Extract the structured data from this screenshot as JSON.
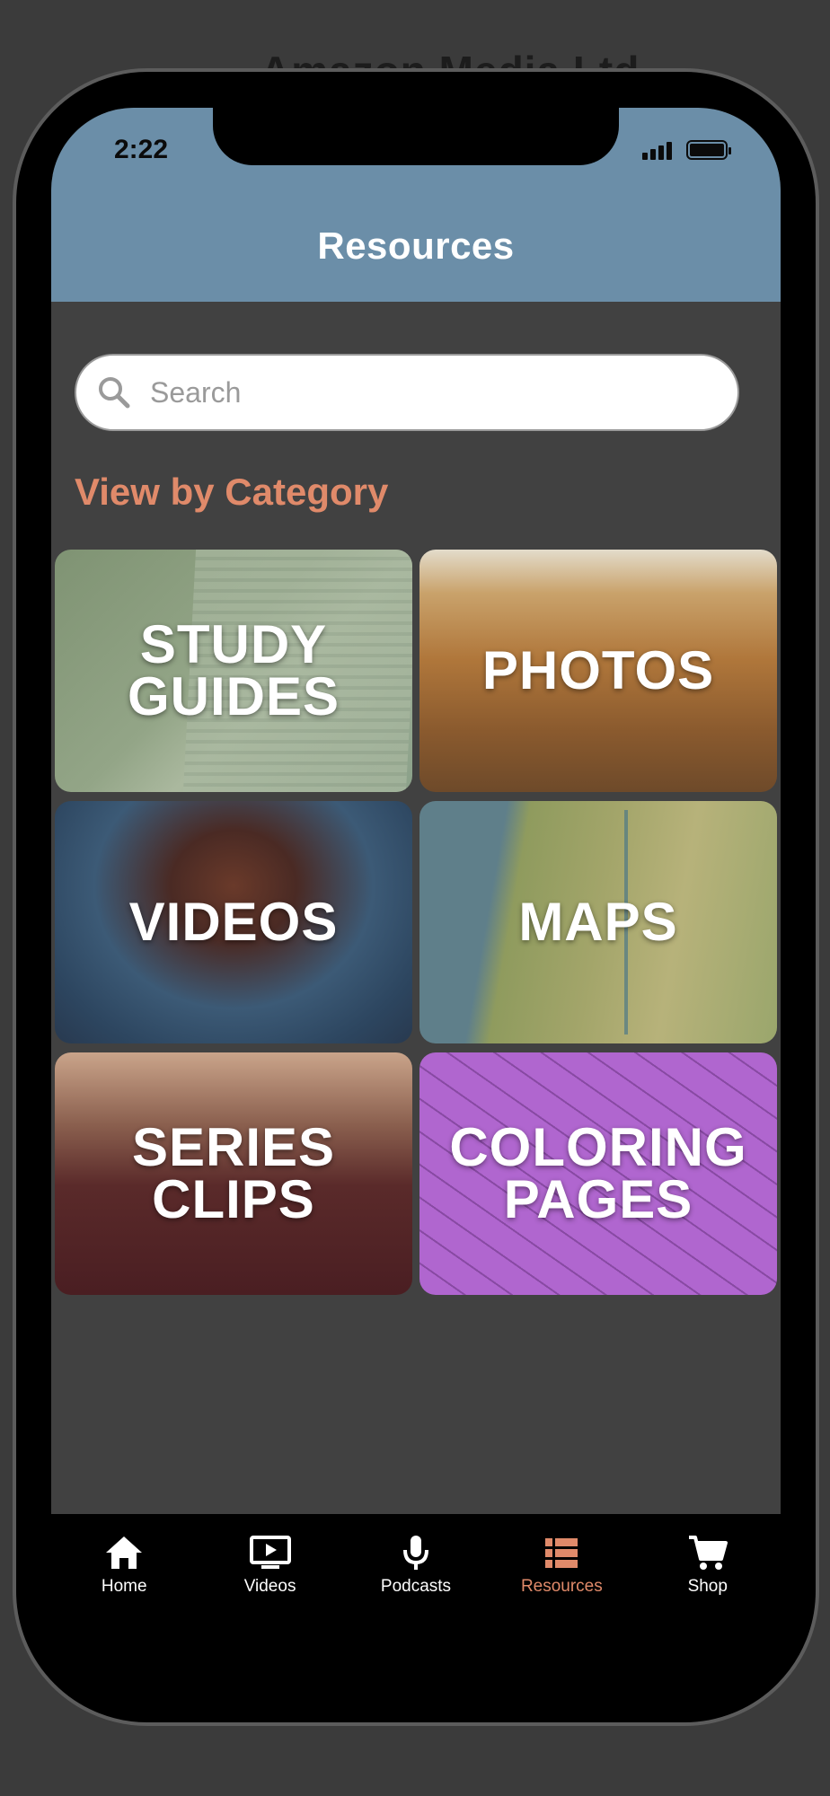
{
  "backdrop": {
    "title": "Amazon Media Ltd"
  },
  "status_bar": {
    "time": "2:22",
    "icons": [
      "cellular-signal-icon",
      "battery-icon"
    ]
  },
  "header": {
    "title": "Resources",
    "color": "#6b8ea8"
  },
  "search": {
    "placeholder": "Search",
    "value": "",
    "icon": "search-icon"
  },
  "section": {
    "heading": "View by Category",
    "heading_color": "#e08a6a"
  },
  "categories": [
    {
      "label_lines": [
        "STUDY",
        "GUIDES"
      ]
    },
    {
      "label_lines": [
        "PHOTOS"
      ]
    },
    {
      "label_lines": [
        "VIDEOS"
      ]
    },
    {
      "label_lines": [
        "MAPS"
      ]
    },
    {
      "label_lines": [
        "SERIES",
        "CLIPS"
      ]
    },
    {
      "label_lines": [
        "COLORING",
        "PAGES"
      ]
    }
  ],
  "tabbar": {
    "active_color": "#e08a6a",
    "items": [
      {
        "label": "Home",
        "icon": "home-icon"
      },
      {
        "label": "Videos",
        "icon": "video-play-icon"
      },
      {
        "label": "Podcasts",
        "icon": "microphone-icon"
      },
      {
        "label": "Resources",
        "icon": "list-icon",
        "active": true
      },
      {
        "label": "Shop",
        "icon": "shopping-cart-icon"
      }
    ]
  }
}
